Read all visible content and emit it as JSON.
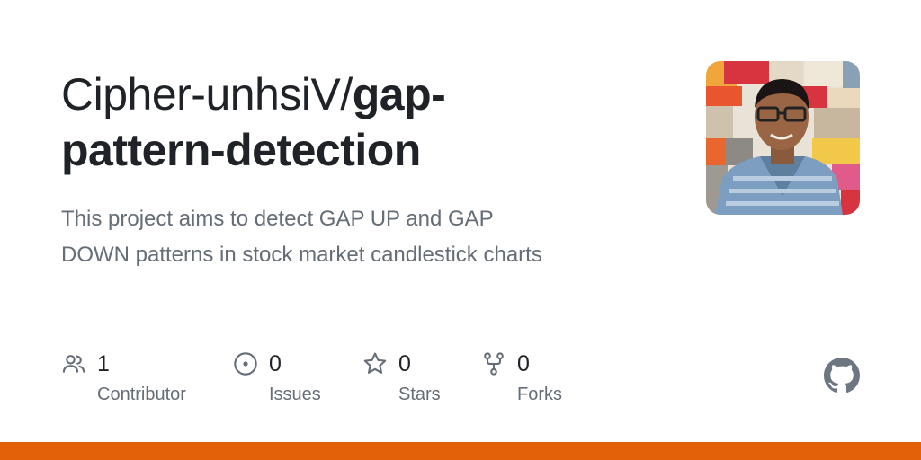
{
  "repo": {
    "owner": "Cipher-unhsiV/",
    "name_line1": "gap-",
    "name_line2": "pattern-detection",
    "description_line1": "This project aims to detect GAP UP and GAP",
    "description_line2": "DOWN patterns in stock market candlestick charts"
  },
  "stats": [
    {
      "icon": "people-icon",
      "count": "1",
      "label": "Contributor"
    },
    {
      "icon": "issue-icon",
      "count": "0",
      "label": "Issues"
    },
    {
      "icon": "star-icon",
      "count": "0",
      "label": "Stars"
    },
    {
      "icon": "fork-icon",
      "count": "0",
      "label": "Forks"
    }
  ],
  "colors": {
    "title": "#1f2328",
    "muted": "#656d76",
    "icon": "#656d76",
    "bottom_bar": "#e36209",
    "github_logo": "#6e7781"
  },
  "logo": "github-logo-icon"
}
